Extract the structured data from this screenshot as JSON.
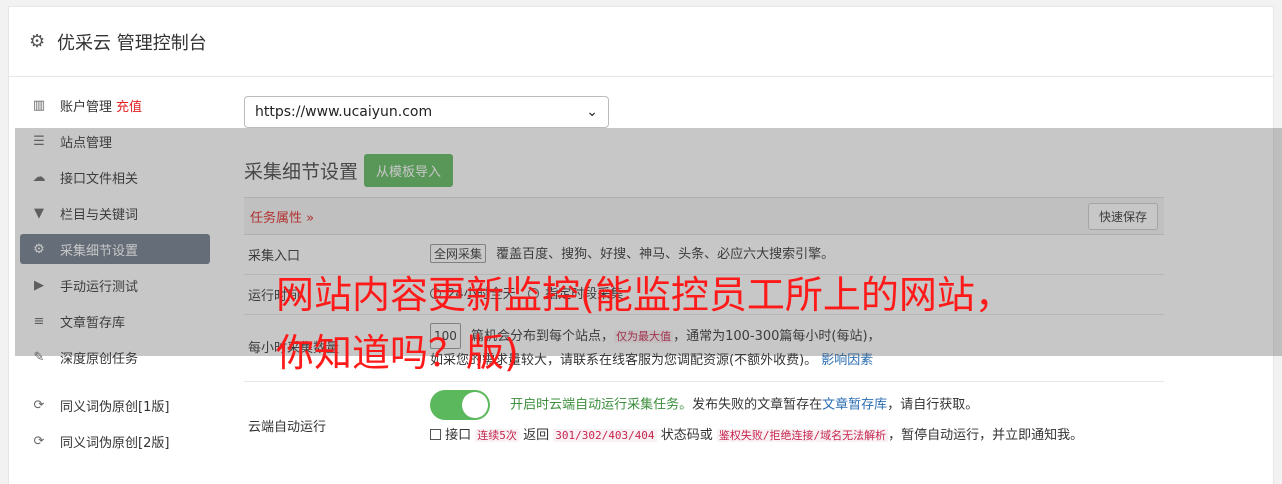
{
  "header": {
    "title": "优采云 管理控制台"
  },
  "sidebar": {
    "items": [
      {
        "label": "账户管理",
        "icon": "bar-chart-icon",
        "extra": "充值"
      },
      {
        "label": "站点管理",
        "icon": "server-icon"
      },
      {
        "label": "接口文件相关",
        "icon": "cloud-upload-icon"
      },
      {
        "label": "栏目与关键词",
        "icon": "filter-icon"
      },
      {
        "label": "采集细节设置",
        "icon": "gears-icon"
      },
      {
        "label": "手动运行测试",
        "icon": "play-circle-icon"
      },
      {
        "label": "文章暂存库",
        "icon": "database-icon"
      },
      {
        "label": "深度原创任务",
        "icon": "edit-icon"
      },
      {
        "label": "同义词伪原创[1版]",
        "icon": "refresh-icon"
      },
      {
        "label": "同义词伪原创[2版]",
        "icon": "refresh-icon"
      }
    ]
  },
  "main": {
    "site_select": "https://www.ucaiyun.com",
    "section_title": "采集细节设置",
    "import_button": "从模板导入",
    "task_attr": "任务属性 »",
    "quick_save": "快速保存",
    "rows": {
      "entry_label": "采集入口",
      "entry_select": "全网采集",
      "entry_desc": "覆盖百度、搜狗、好搜、神马、头条、必应六大搜索引擎。",
      "time_label": "运行时间",
      "time_opt1": "24小时全天",
      "time_opt2": "指定时段采集",
      "count_label": "每小时采集数量",
      "count_select": "100",
      "count_desc_a": "篇机会分布到每个站点，",
      "count_desc_b": "仅为最大值",
      "count_desc_c": "，通常为100-300篇每小时(每站)，",
      "count_desc_d": "如采您的需求量较大，请联系在线客服为您调配资源(不额外收费)。",
      "count_link": "影响因素",
      "cloud_label": "云端自动运行",
      "cloud_on": "开启时云端自动运行采集任务。",
      "cloud_desc_a": "发布失败的文章暂存在",
      "cloud_link": "文章暂存库",
      "cloud_desc_b": "，请自行获取。",
      "api_a": "接口",
      "api_code1": "连续5次",
      "api_b": "返回",
      "api_code2": "301/302/403/404",
      "api_c": "状态码或",
      "api_code3": "鉴权失败/拒绝连接/域名无法解析",
      "api_d": "，暂停自动运行，并立即通知我。"
    }
  },
  "overlay": {
    "text": "网站内容更新监控(能监控员工所上的网站，你知道吗？版)"
  }
}
